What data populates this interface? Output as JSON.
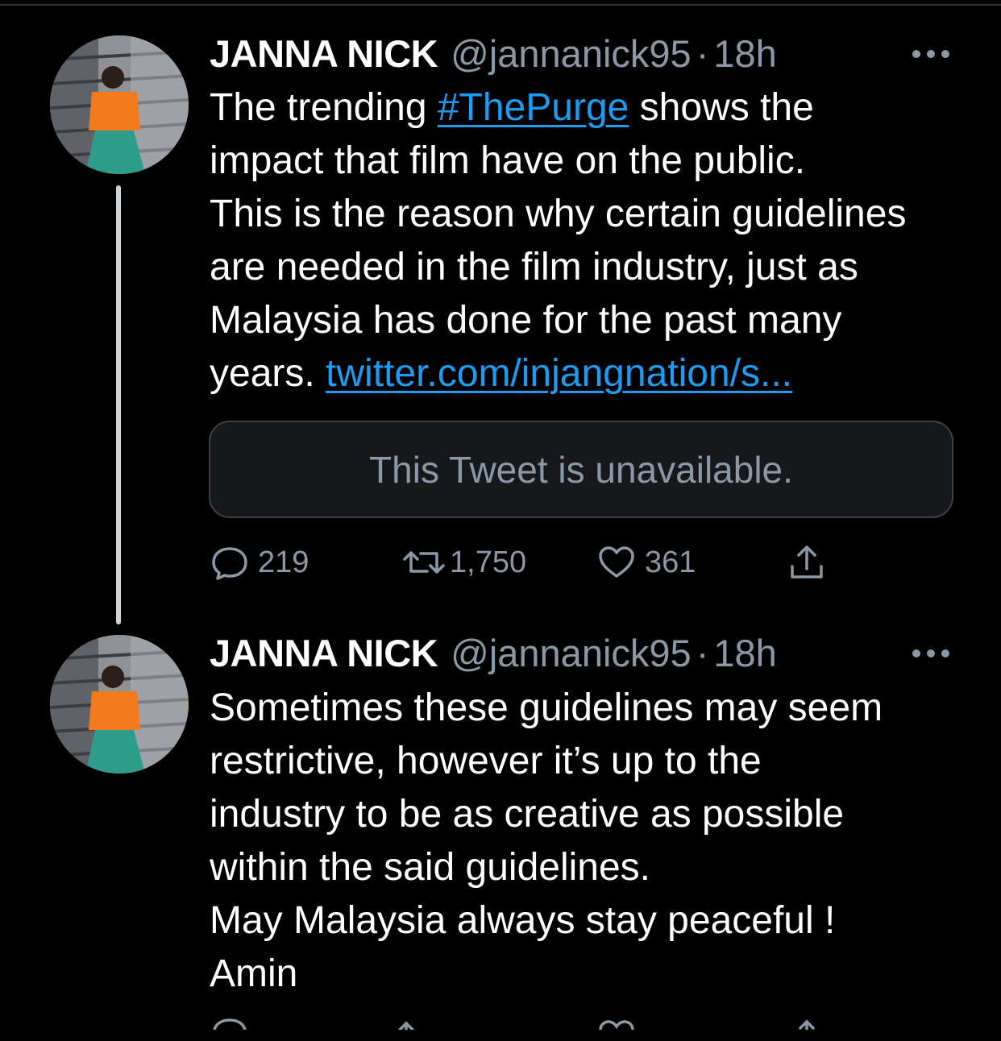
{
  "tweets": [
    {
      "name": "JANNA NICK",
      "handle": "@jannanick95",
      "separator": "·",
      "time": "18h",
      "text": {
        "line1_before": "The trending ",
        "hashtag": "#ThePurge",
        "line1_after": " shows the",
        "line2": "impact that film have on the public.",
        "line3": "This is the reason why certain guidelines",
        "line4": "are needed in the film industry, just as",
        "line5": "Malaysia has done for the past many",
        "line6_before": "years. ",
        "link": "twitter.com/injangnation/s..."
      },
      "quote": "This Tweet is unavailable.",
      "actions": {
        "replies": "219",
        "retweets": "1,750",
        "likes": "361"
      }
    },
    {
      "name": "JANNA NICK",
      "handle": "@jannanick95",
      "separator": "·",
      "time": "18h",
      "text": {
        "line1": "Sometimes these guidelines may seem",
        "line2": "restrictive, however it’s up to the",
        "line3": "industry to be as creative as possible",
        "line4": "within the said guidelines.",
        "line5": "May Malaysia always stay peaceful !",
        "line6": "Amin"
      }
    }
  ],
  "colors": {
    "background": "#000000",
    "text": "#ffffff",
    "secondary": "#8b98a5",
    "link": "#1d9bf0"
  },
  "icons": {
    "reply": "speech-bubble-icon",
    "retweet": "retweet-arrows-icon",
    "like": "heart-icon",
    "share": "share-upload-icon",
    "more": "more-dots-icon"
  }
}
